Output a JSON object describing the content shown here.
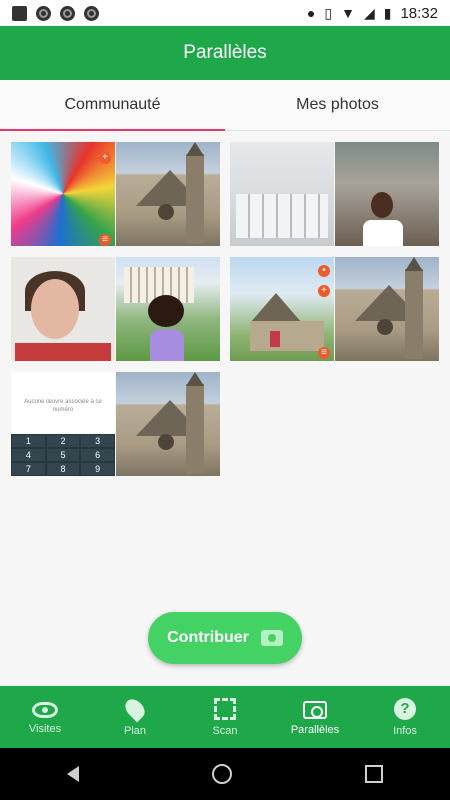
{
  "status_bar": {
    "time": "18:32"
  },
  "app_bar": {
    "title": "Parallèles"
  },
  "tabs": [
    {
      "label": "Communauté",
      "active": true
    },
    {
      "label": "Mes photos",
      "active": false
    }
  ],
  "grid": {
    "phone_message": "Aucune œuvre associée à ce numéro",
    "keypad": [
      "1",
      "2",
      "3",
      "4",
      "5",
      "6",
      "7",
      "8",
      "9"
    ]
  },
  "fab": {
    "label": "Contribuer"
  },
  "bottom_nav": [
    {
      "label": "Visites",
      "icon": "eye-icon"
    },
    {
      "label": "Plan",
      "icon": "map-pin-icon"
    },
    {
      "label": "Scan",
      "icon": "scan-icon"
    },
    {
      "label": "Parallèles",
      "icon": "camera-icon",
      "active": true
    },
    {
      "label": "Infos",
      "icon": "help-icon"
    }
  ],
  "colors": {
    "primary": "#1fa84a",
    "accent": "#e8336b",
    "fab": "#44d264"
  }
}
